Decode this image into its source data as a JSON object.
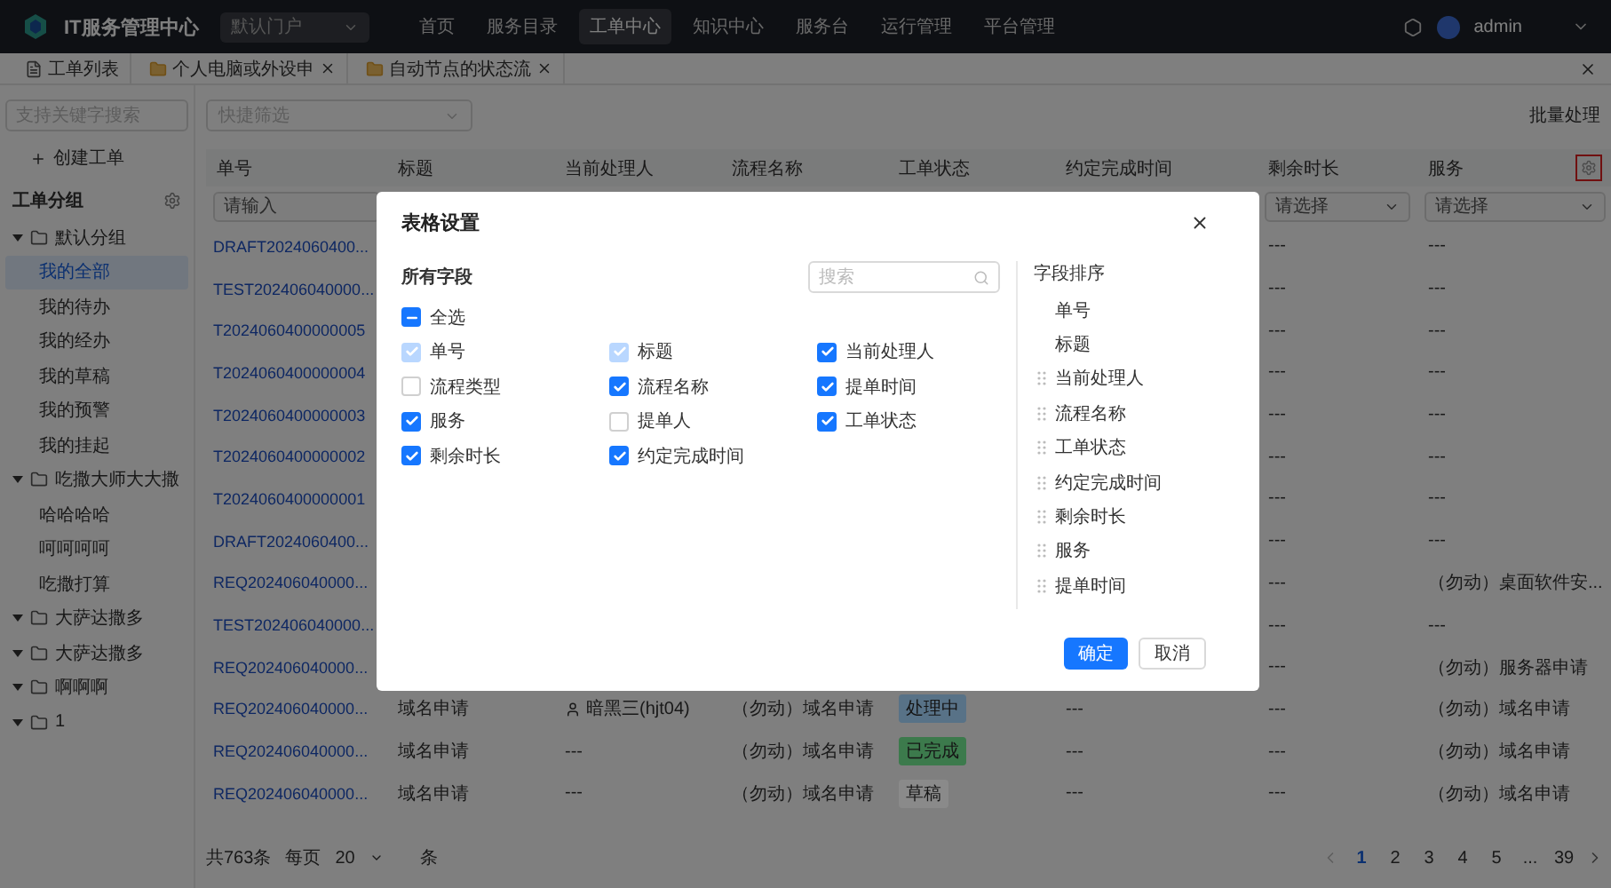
{
  "app": {
    "title": "IT服务管理中心",
    "portal": "默认门户",
    "user": "admin",
    "nav": [
      {
        "label": "首页",
        "selected": false
      },
      {
        "label": "服务目录",
        "selected": false
      },
      {
        "label": "工单中心",
        "selected": true
      },
      {
        "label": "知识中心",
        "selected": false
      },
      {
        "label": "服务台",
        "selected": false
      },
      {
        "label": "运行管理",
        "selected": false
      },
      {
        "label": "平台管理",
        "selected": false
      }
    ]
  },
  "tabs": [
    {
      "label": "工单列表",
      "kind": "list",
      "closable": false
    },
    {
      "label": "个人电脑或外设申",
      "kind": "form",
      "closable": true
    },
    {
      "label": "自动节点的状态流",
      "kind": "form",
      "closable": true
    }
  ],
  "sidebar": {
    "search_placeholder": "支持关键字搜索",
    "create_label": "创建工单",
    "group_title": "工单分组",
    "groups": [
      {
        "label": "默认分组",
        "expanded": true,
        "children": [
          {
            "label": "我的全部",
            "selected": true
          },
          {
            "label": "我的待办",
            "selected": false
          },
          {
            "label": "我的经办",
            "selected": false
          },
          {
            "label": "我的草稿",
            "selected": false
          },
          {
            "label": "我的预警",
            "selected": false
          },
          {
            "label": "我的挂起",
            "selected": false
          }
        ]
      },
      {
        "label": "吃撒大师大大撒",
        "expanded": true,
        "children": [
          {
            "label": "哈哈哈哈",
            "selected": false
          },
          {
            "label": "呵呵呵呵",
            "selected": false
          },
          {
            "label": "吃撒打算",
            "selected": false
          }
        ]
      },
      {
        "label": "大萨达撒多",
        "expanded": true
      },
      {
        "label": "大萨达撒多",
        "expanded": true
      },
      {
        "label": "啊啊啊",
        "expanded": true
      },
      {
        "label": "1",
        "expanded": true
      }
    ]
  },
  "toolbar": {
    "quick_filter_placeholder": "快捷筛选",
    "batch_button": "批量处理"
  },
  "table": {
    "columns": [
      {
        "label": "单号",
        "filter": {
          "kind": "input",
          "placeholder": "请输入"
        }
      },
      {
        "label": "标题"
      },
      {
        "label": "当前处理人"
      },
      {
        "label": "流程名称"
      },
      {
        "label": "工单状态"
      },
      {
        "label": "约定完成时间"
      },
      {
        "label": "剩余时长",
        "filter": {
          "kind": "select",
          "placeholder": "请选择"
        }
      },
      {
        "label": "服务",
        "filter": {
          "kind": "select",
          "placeholder": "请选择"
        }
      }
    ],
    "rows": [
      {
        "number": "DRAFT2024060400...",
        "remaining": "---",
        "service": "---"
      },
      {
        "number": "TEST202406040000...",
        "remaining": "---",
        "service": "---"
      },
      {
        "number": "T2024060400000005",
        "remaining": "---",
        "service": "---"
      },
      {
        "number": "T2024060400000004",
        "remaining": "---",
        "service": "---"
      },
      {
        "number": "T2024060400000003",
        "remaining": "---",
        "service": "---"
      },
      {
        "number": "T2024060400000002",
        "remaining": "---",
        "service": "---"
      },
      {
        "number": "T2024060400000001",
        "remaining": "---",
        "service": "---"
      },
      {
        "number": "DRAFT2024060400...",
        "remaining": "---",
        "service": "---"
      },
      {
        "number": "REQ202406040000...",
        "remaining": "---",
        "service": "（勿动）桌面软件安..."
      },
      {
        "number": "TEST202406040000...",
        "remaining": "---",
        "service": "---"
      },
      {
        "number": "REQ202406040000...",
        "remaining": "---",
        "service": "（勿动）服务器申请"
      },
      {
        "number": "REQ202406040000...",
        "title": "域名申请",
        "handler": {
          "kind": "user",
          "text": "暗黑三(hjt04)"
        },
        "process": "（勿动）域名申请",
        "status": {
          "text": "处理中",
          "color": "#587287"
        },
        "due": "---",
        "remaining": "---",
        "service": "（勿动）域名申请"
      },
      {
        "number": "REQ202406040000...",
        "title": "域名申请",
        "handler": {
          "kind": "empty",
          "text": "---"
        },
        "process": "（勿动）域名申请",
        "status": {
          "text": "已完成",
          "color": "#3c7a4c"
        },
        "due": "---",
        "remaining": "---",
        "service": "（勿动）域名申请"
      },
      {
        "number": "REQ202406040000...",
        "title": "域名申请",
        "handler": {
          "kind": "empty",
          "text": "---"
        },
        "process": "（勿动）域名申请",
        "status": {
          "text": "草稿",
          "color": "#8a8a8a"
        },
        "due": "---",
        "remaining": "---",
        "service": "（勿动）域名申请"
      }
    ]
  },
  "pagination": {
    "total": "共763条",
    "per_page_label": "每页",
    "page_size": "20",
    "unit": "条",
    "pages": [
      {
        "label": "1",
        "selected": true
      },
      {
        "label": "2",
        "selected": false
      },
      {
        "label": "3",
        "selected": false
      },
      {
        "label": "4",
        "selected": false
      },
      {
        "label": "5",
        "selected": false
      },
      {
        "label": "...",
        "selected": false
      },
      {
        "label": "39",
        "selected": false
      }
    ]
  },
  "dialog": {
    "title": "表格设置",
    "fields_title": "所有字段",
    "search_placeholder": "搜索",
    "select_all": {
      "label": "全选",
      "indeterminate": true
    },
    "fields": [
      {
        "label": "单号",
        "checked": true,
        "disabled": true
      },
      {
        "label": "标题",
        "checked": true,
        "disabled": true
      },
      {
        "label": "当前处理人",
        "checked": true,
        "disabled": false
      },
      {
        "label": "流程类型",
        "checked": false,
        "disabled": false
      },
      {
        "label": "流程名称",
        "checked": true,
        "disabled": false
      },
      {
        "label": "提单时间",
        "checked": true,
        "disabled": false
      },
      {
        "label": "服务",
        "checked": true,
        "disabled": false
      },
      {
        "label": "提单人",
        "checked": false,
        "disabled": false
      },
      {
        "label": "工单状态",
        "checked": true,
        "disabled": false
      },
      {
        "label": "剩余时长",
        "checked": true,
        "disabled": false
      },
      {
        "label": "约定完成时间",
        "checked": true,
        "disabled": false
      }
    ],
    "order_title": "字段排序",
    "order": [
      {
        "label": "单号",
        "draggable": false
      },
      {
        "label": "标题",
        "draggable": false
      },
      {
        "label": "当前处理人",
        "draggable": true
      },
      {
        "label": "流程名称",
        "draggable": true
      },
      {
        "label": "工单状态",
        "draggable": true
      },
      {
        "label": "约定完成时间",
        "draggable": true
      },
      {
        "label": "剩余时长",
        "draggable": true
      },
      {
        "label": "服务",
        "draggable": true
      },
      {
        "label": "提单时间",
        "draggable": true
      }
    ],
    "confirm": "确定",
    "cancel": "取消"
  }
}
